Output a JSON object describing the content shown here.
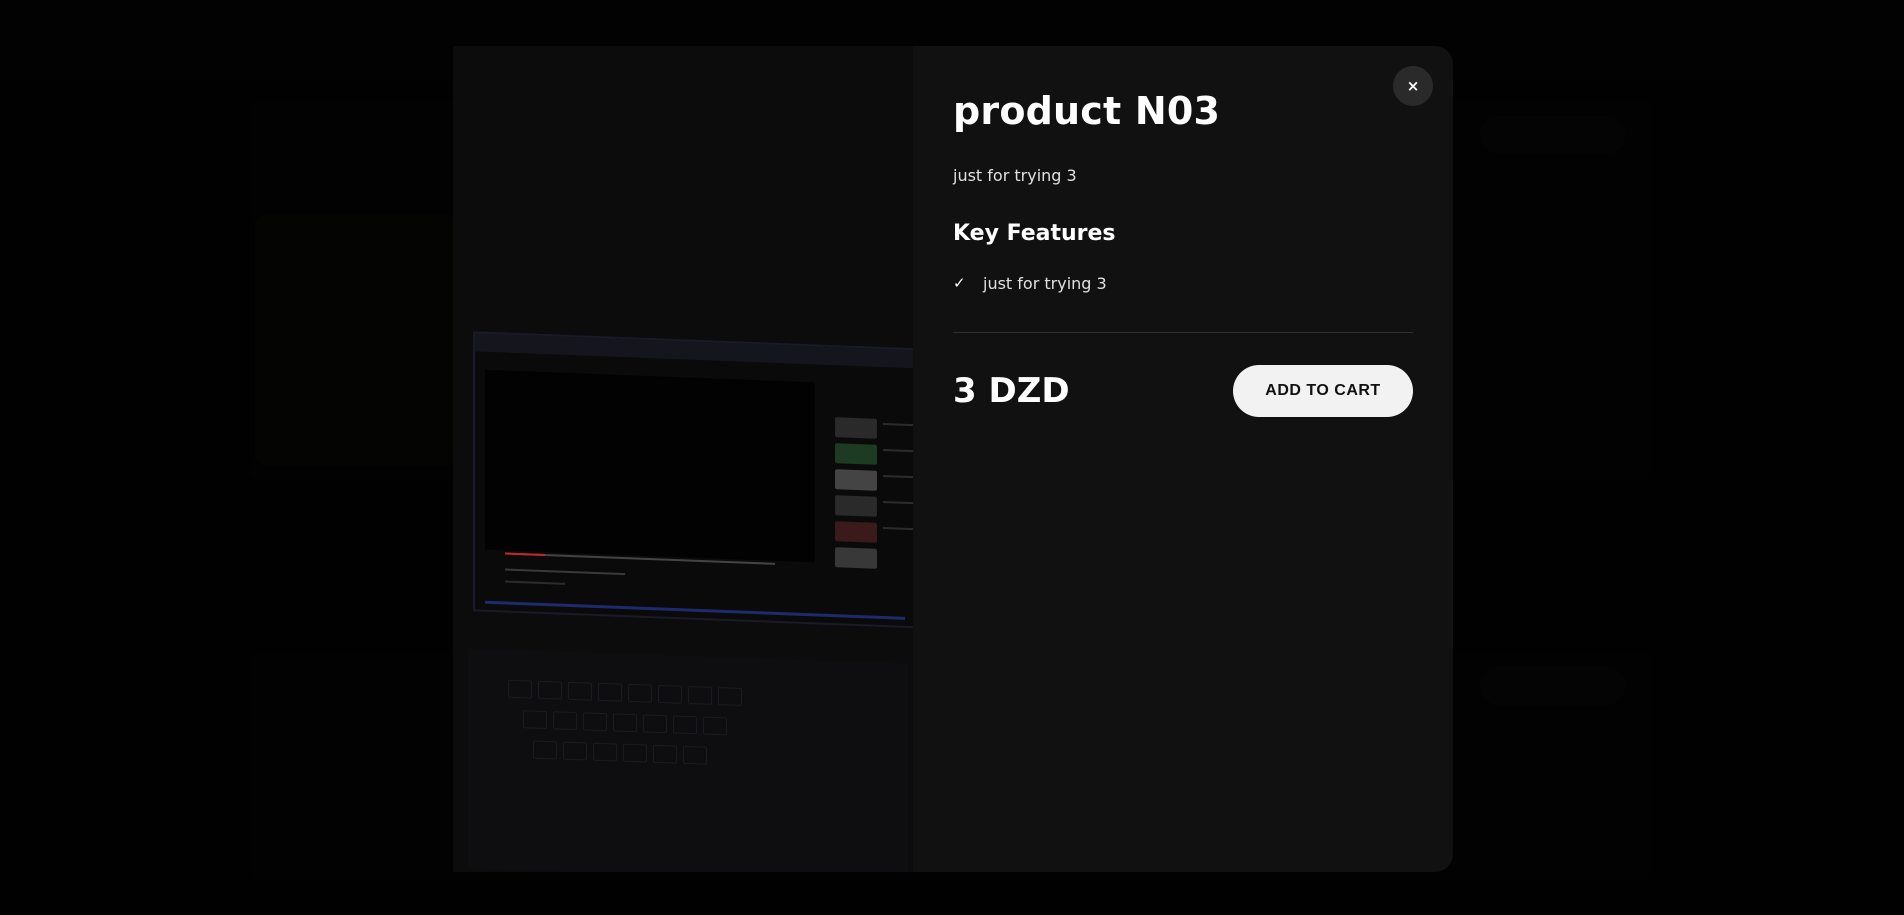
{
  "modal": {
    "title": "product N03",
    "description": "just for trying 3",
    "features_heading": "Key Features",
    "features": [
      {
        "check_icon": "✓",
        "text": "just for trying 3"
      }
    ],
    "price": "3 DZD",
    "add_to_cart_label": "ADD TO CART",
    "close_label": "×",
    "image_icon": "laptop-photo"
  },
  "colors": {
    "modal_background": "#111111",
    "button_background": "#f2f2f2",
    "overlay": "#000000"
  }
}
